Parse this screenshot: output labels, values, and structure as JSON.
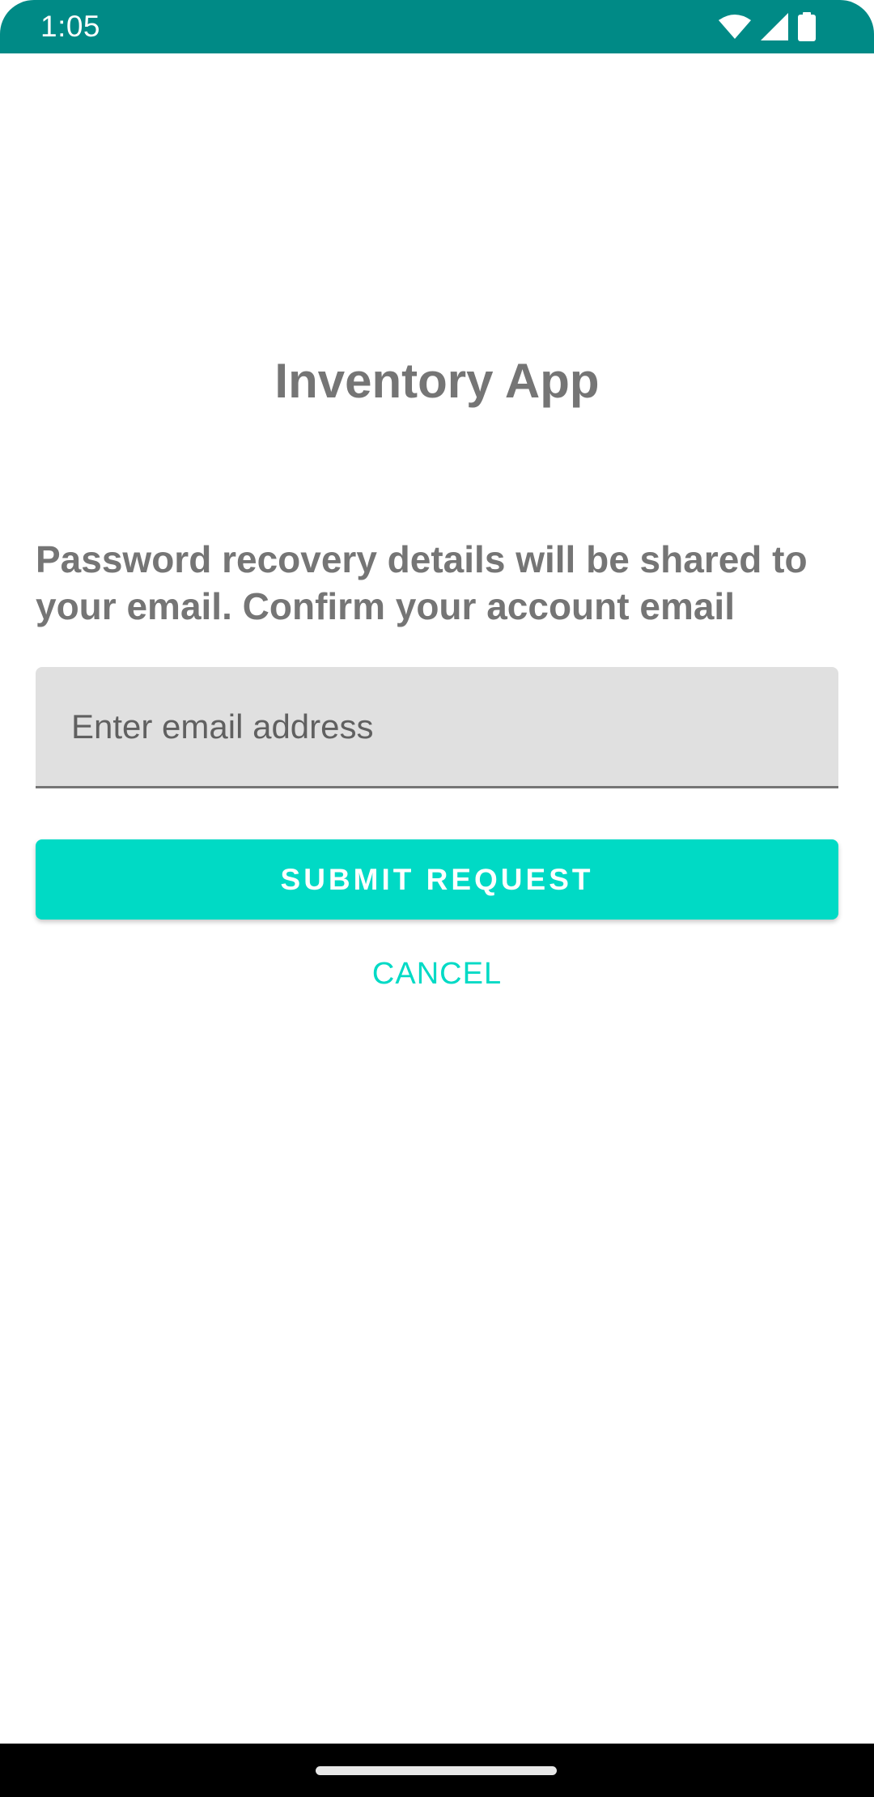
{
  "status_bar": {
    "time": "1:05",
    "icons": [
      "wifi-icon",
      "signal-icon",
      "battery-icon"
    ],
    "background_color": "#008a86"
  },
  "app": {
    "title": "Inventory App"
  },
  "recovery": {
    "instructions": "Password recovery details will be shared to your email. Confirm your account email",
    "email_value": "",
    "email_placeholder": "Enter email address",
    "submit_label": "SUBMIT REQUEST",
    "cancel_label": "CANCEL"
  },
  "colors": {
    "accent": "#00dac5",
    "text_gray": "#757575",
    "field_background": "#e0e0e0"
  },
  "navigation": {
    "home_handle": "home-handle"
  }
}
